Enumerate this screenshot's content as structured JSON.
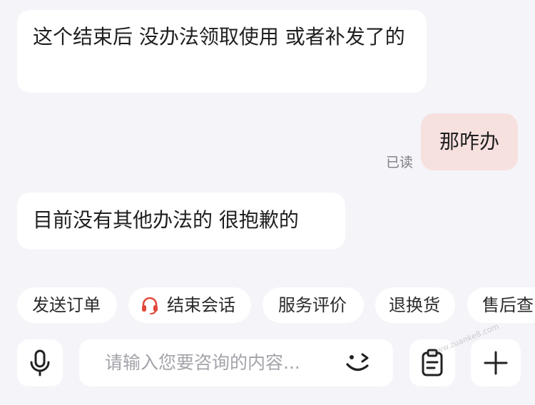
{
  "messages": [
    {
      "sender": "agent",
      "text": "这个结束后 没办法领取使用  或者补发了的"
    },
    {
      "sender": "user",
      "text": "那咋办",
      "status": "已读"
    },
    {
      "sender": "agent",
      "text": "目前没有其他办法的 很抱歉的"
    }
  ],
  "quick_actions": [
    {
      "label": "发送订单"
    },
    {
      "label": "结束会话",
      "icon": "headset-icon"
    },
    {
      "label": "服务评价"
    },
    {
      "label": "退换货"
    },
    {
      "label": "售后查"
    }
  ],
  "input": {
    "placeholder": "请输入您要咨询的内容...",
    "value": ""
  },
  "watermark": "www.zuanke8.com",
  "colors": {
    "background": "#f4f4f9",
    "agent_bubble": "#ffffff",
    "user_bubble": "#f7e1df",
    "headset_icon": "#e2483a",
    "placeholder": "#a3a3aa"
  }
}
